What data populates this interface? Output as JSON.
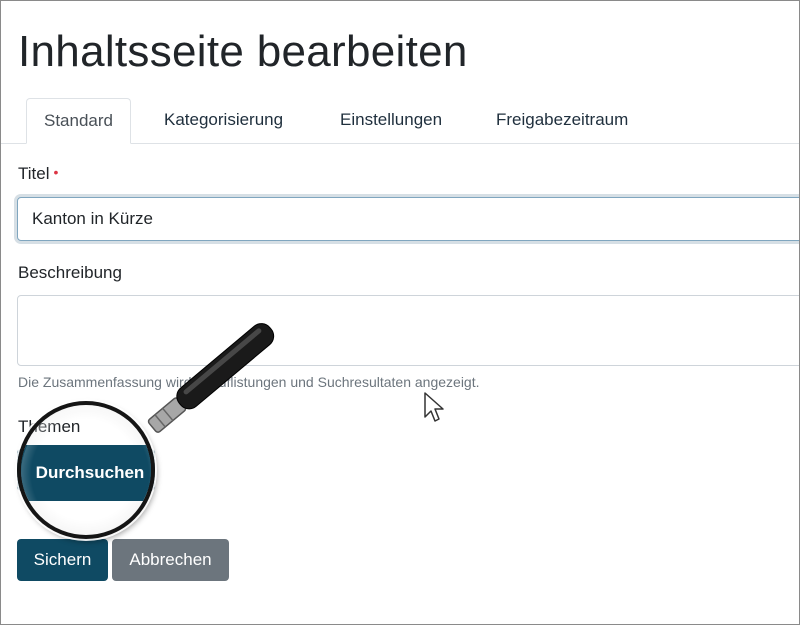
{
  "page": {
    "title": "Inhaltsseite bearbeiten"
  },
  "tabs": [
    {
      "label": "Standard",
      "active": true
    },
    {
      "label": "Kategorisierung",
      "active": false
    },
    {
      "label": "Einstellungen",
      "active": false
    },
    {
      "label": "Freigabezeitraum",
      "active": false
    }
  ],
  "form": {
    "title_label": "Titel",
    "title_required_marker": "•",
    "title_value": "Kanton in Kürze",
    "description_label": "Beschreibung",
    "description_value": "",
    "description_help": "Die Zusammenfassung wird in Auflistungen und Suchresultaten angezeigt.",
    "themes_label": "Themen",
    "browse_label": "Durchsuchen"
  },
  "actions": {
    "save_label": "Sichern",
    "cancel_label": "Abbrechen"
  },
  "overlay": {
    "magnifier_icon": "magnifier-icon",
    "cursor_icon": "mouse-pointer-icon"
  },
  "colors": {
    "primary": "#0f4a63",
    "secondary": "#6c757d",
    "required": "#dc3545"
  }
}
